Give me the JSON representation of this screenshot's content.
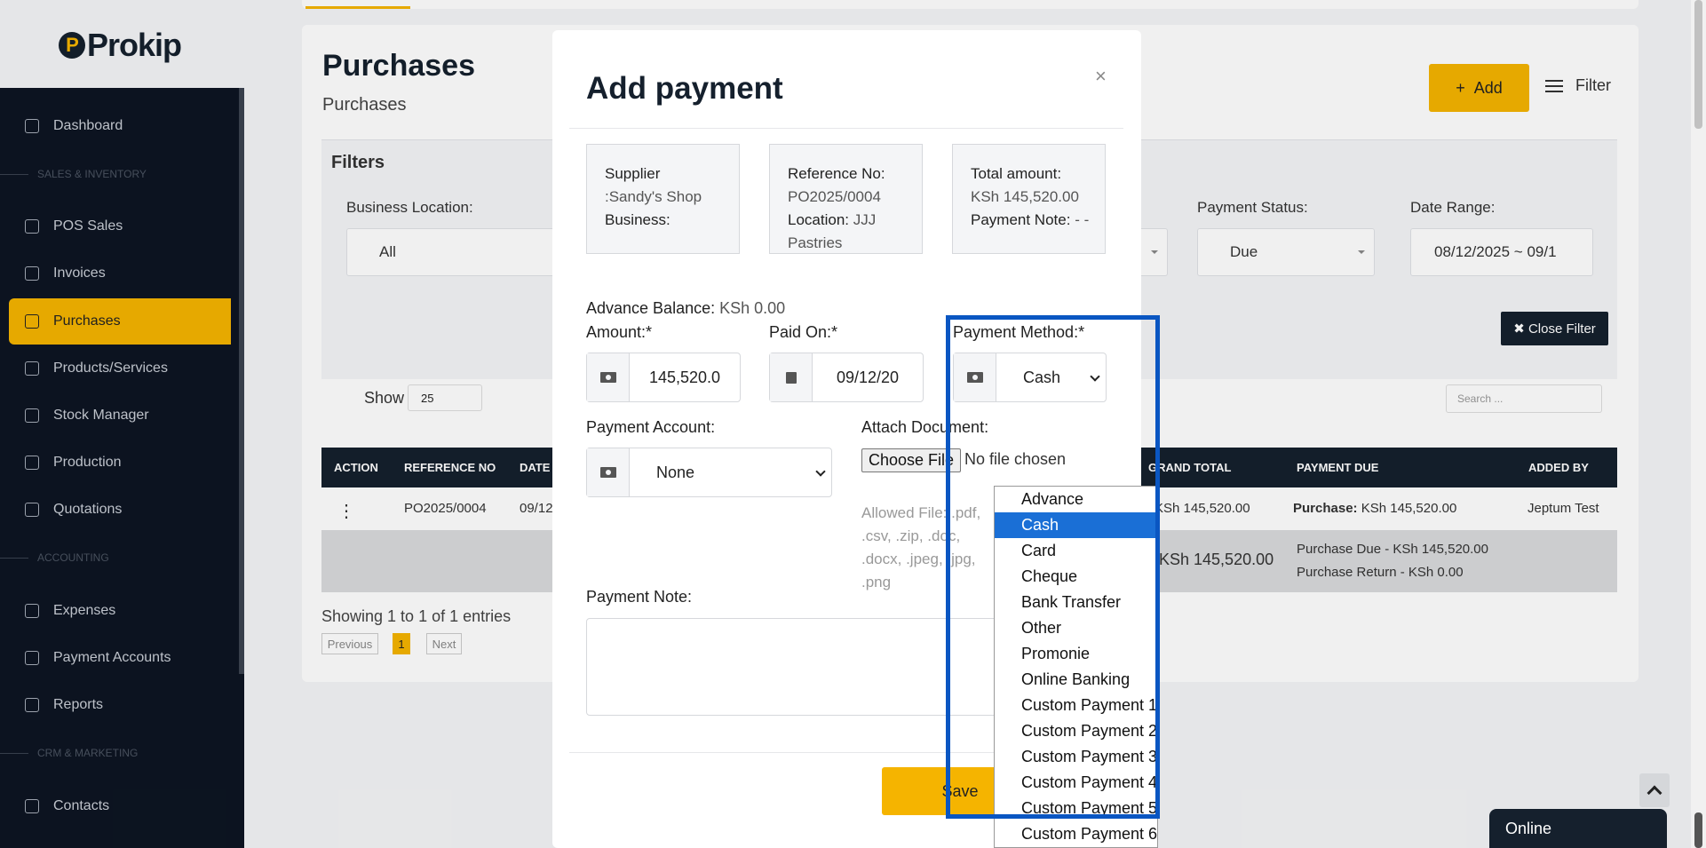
{
  "app": {
    "logo": "Prokip",
    "logo_mark": "P"
  },
  "sidebar": {
    "items": [
      {
        "label": "Dashboard"
      },
      {
        "label": "POS Sales"
      },
      {
        "label": "Invoices"
      },
      {
        "label": "Purchases",
        "active": true
      },
      {
        "label": "Products/Services"
      },
      {
        "label": "Stock Manager"
      },
      {
        "label": "Production"
      },
      {
        "label": "Quotations"
      },
      {
        "label": "Expenses"
      },
      {
        "label": "Payment Accounts"
      },
      {
        "label": "Reports"
      },
      {
        "label": "Contacts"
      }
    ],
    "sections": [
      "SALES & INVENTORY",
      "ACCOUNTING",
      "CRM & MARKETING"
    ]
  },
  "page": {
    "title": "Purchases",
    "subtitle": "Purchases",
    "add_label": "Add",
    "filter_label": "Filter",
    "filters_title": "Filters",
    "filters": {
      "business_location_label": "Business Location:",
      "business_location_value": "All",
      "payment_status_label": "Payment Status:",
      "payment_status_value": "Due",
      "date_range_label": "Date Range:",
      "date_range_value": "08/12/2025 ~ 09/1"
    },
    "close_filter": "Close Filter",
    "show_label": "Show",
    "show_value": "25",
    "search_placeholder": "Search ...",
    "table": {
      "headers": [
        "ACTION",
        "REFERENCE NO",
        "DATE",
        "GRAND TOTAL",
        "PAYMENT DUE",
        "ADDED BY"
      ],
      "row": {
        "action": "⋮",
        "reference": "PO2025/0004",
        "date": "09/12",
        "grand_total": "KSh 145,520.00",
        "payment_due_label": "Purchase:",
        "payment_due_value": "KSh 145,520.00",
        "added_by": "Jeptum Test"
      },
      "summary": {
        "grand_total": "KSh 145,520.00",
        "purchase_due": "Purchase Due - KSh 145,520.00",
        "purchase_return": "Purchase Return - KSh 0.00"
      }
    },
    "showing": "Showing 1 to 1 of 1 entries",
    "pagination": {
      "previous": "Previous",
      "current": "1",
      "next": "Next"
    }
  },
  "modal": {
    "title": "Add payment",
    "close": "×",
    "supplier_label": "Supplier",
    "supplier_value": ":Sandy's Shop",
    "business_label": "Business:",
    "reference_label": "Reference No:",
    "reference_value": "PO2025/0004",
    "location_label": "Location:",
    "location_value": "JJJ Pastries",
    "total_label": "Total amount:",
    "total_value": "KSh 145,520.00",
    "payment_note_label": "Payment Note:",
    "payment_note_value": "- -",
    "advance_balance_label": "Advance Balance:",
    "advance_balance_value": "KSh 0.00",
    "amount_label": "Amount:*",
    "amount_value": "145,520.0",
    "paid_on_label": "Paid On:*",
    "paid_on_value": "09/12/20",
    "method_label": "Payment Method:*",
    "method_value": "Cash",
    "account_label": "Payment Account:",
    "account_value": "None",
    "attach_label": "Attach Document:",
    "choose_file": "Choose File",
    "no_file": "No file chosen",
    "allowed_files": "Allowed File: .pdf, .csv, .zip, .doc, .docx, .jpeg, .jpg, .png",
    "note_label": "Payment Note:",
    "save_label": "Save"
  },
  "dropdown": {
    "options": [
      "Advance",
      "Cash",
      "Card",
      "Cheque",
      "Bank Transfer",
      "Other",
      "Promonie",
      "Online Banking",
      "Custom Payment 1",
      "Custom Payment 2",
      "Custom Payment 3",
      "Custom Payment 4",
      "Custom Payment 5",
      "Custom Payment 6"
    ],
    "selected": "Cash"
  },
  "chat": {
    "status": "Online"
  }
}
